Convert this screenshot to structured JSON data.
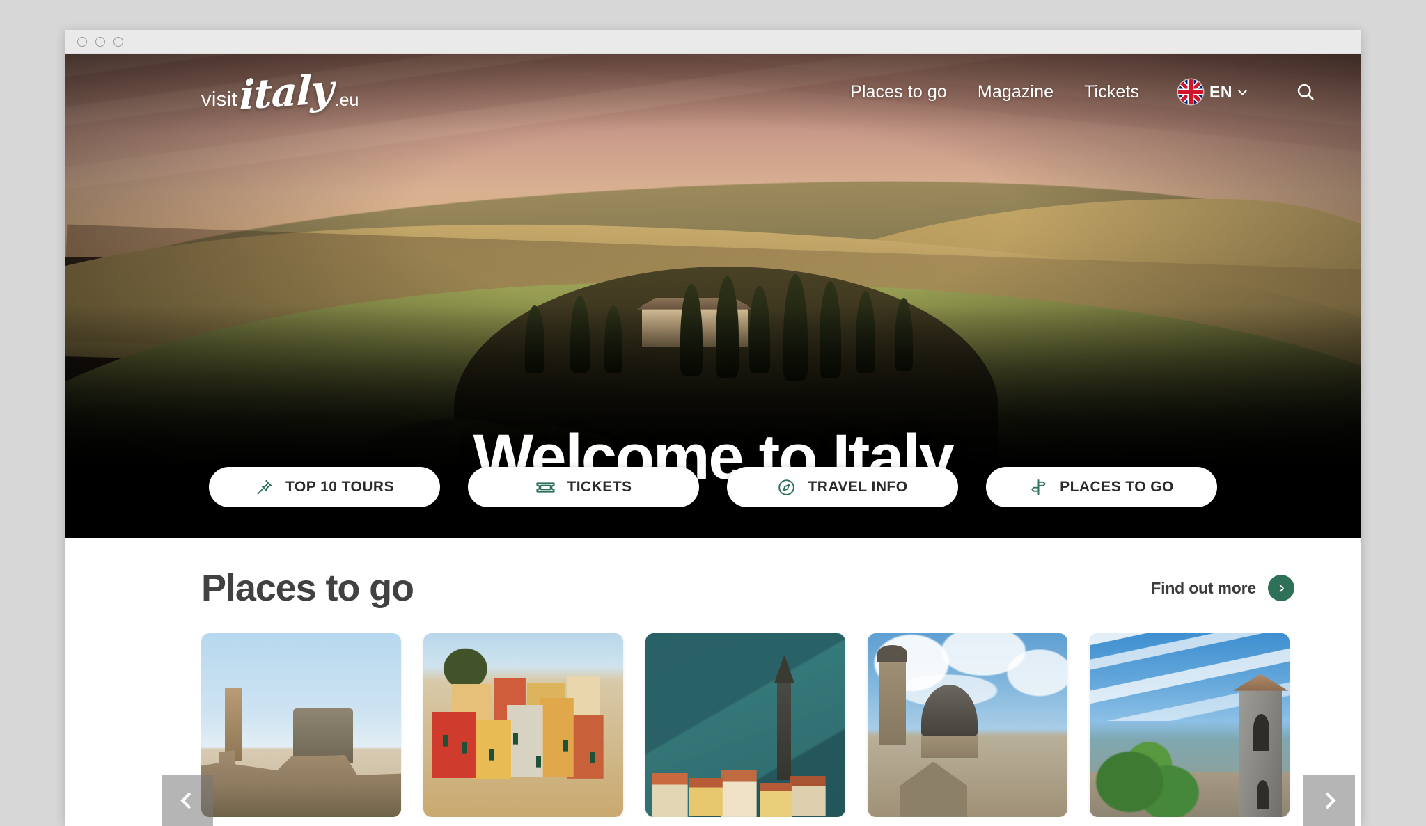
{
  "window": {
    "controls": [
      "minimize",
      "maximize",
      "close"
    ]
  },
  "header": {
    "logo": {
      "part1": "visit",
      "part2": "italy",
      "part3": ".eu"
    },
    "nav": [
      {
        "label": "Places to go"
      },
      {
        "label": "Magazine"
      },
      {
        "label": "Tickets"
      }
    ],
    "language": {
      "code": "EN",
      "flag": "uk-flag-icon"
    },
    "search_icon": "search-icon"
  },
  "hero": {
    "title": "Welcome to Italy",
    "image_alt": "Tuscan rolling hills at sunset with cypress trees and a stone villa",
    "quick_actions": [
      {
        "label": "TOP 10 TOURS",
        "icon": "pin-icon"
      },
      {
        "label": "TICKETS",
        "icon": "ticket-icon"
      },
      {
        "label": "TRAVEL INFO",
        "icon": "compass-icon"
      },
      {
        "label": "PLACES TO GO",
        "icon": "signpost-icon"
      }
    ]
  },
  "places_section": {
    "title": "Places to go",
    "find_out_more": "Find out more",
    "arrow_icon": "chevron-right-icon",
    "cards": [
      {
        "id": "card-1",
        "alt": "Roman Forum and Colosseum under a clear blue sky"
      },
      {
        "id": "card-2",
        "alt": "Colourful cliffside houses of Cinque Terre"
      },
      {
        "id": "card-3",
        "alt": "Lakeside village with bell tower below a forested mountain"
      },
      {
        "id": "card-4",
        "alt": "Cathedral dome and tower against a cloudy sky"
      },
      {
        "id": "card-5",
        "alt": "Stone bell tower above a hilltop town with trees"
      }
    ],
    "carousel": {
      "prev_icon": "chevron-left-icon",
      "next_icon": "chevron-right-icon"
    }
  },
  "colors": {
    "accent_green": "#2E7058",
    "heading_gray": "#414141",
    "pill_text": "#2B2B2B",
    "hero_bar": "#000000"
  }
}
